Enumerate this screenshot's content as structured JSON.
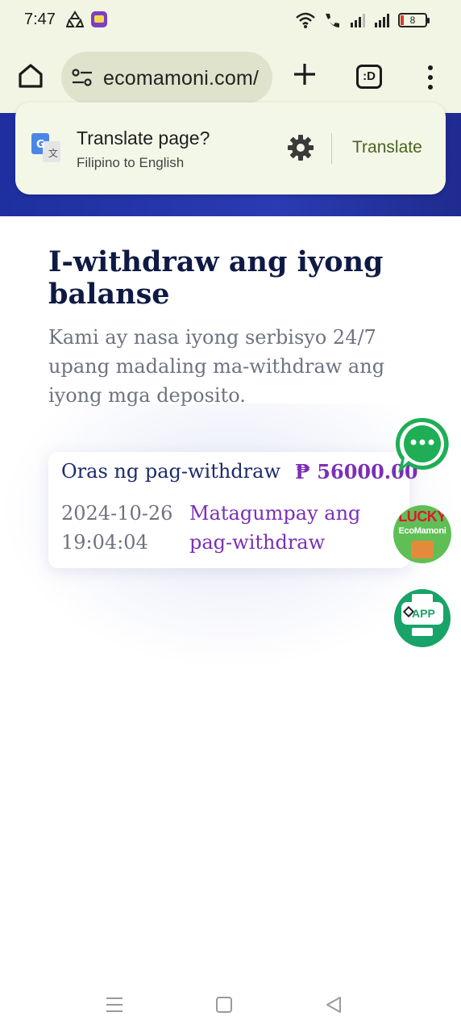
{
  "status_bar": {
    "time": "7:47",
    "battery_level": "8"
  },
  "browser": {
    "url": "ecomamoni.com/",
    "tabs_label": ":D"
  },
  "translate_prompt": {
    "title": "Translate page?",
    "subtitle": "Filipino to English",
    "button_label": "Translate"
  },
  "page": {
    "title": "I-withdraw ang iyong balanse",
    "description": "Kami ay nasa iyong serbisyo 24/7 upang madaling ma-withdraw ang iyong mga deposito.",
    "withdraw_card": {
      "label": "Oras ng pag-withdraw",
      "amount": "₱ 56000.00",
      "datetime": "2024-10-26 19:04:04",
      "status": "Matagumpay ang pag-withdraw"
    }
  },
  "floating": {
    "lucky_title": "LUCKY",
    "lucky_brand": "EcoMamoni",
    "app_label": "APP"
  },
  "colors": {
    "banner": "#1e2f9f",
    "accent_purple": "#7b2fb5",
    "heading_navy": "#0f1a44",
    "toolbar_bg": "#f2f5e4",
    "fab_green": "#18a368"
  }
}
